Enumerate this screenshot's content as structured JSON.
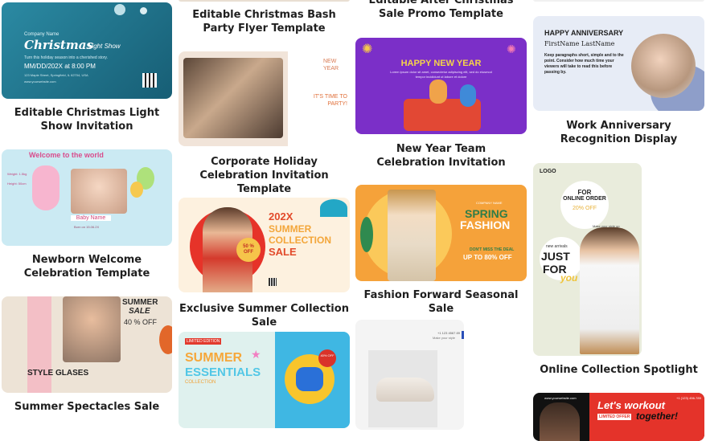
{
  "cards": {
    "christmas_light": {
      "title": "Editable Christmas Light Show Invitation",
      "company": "Company Name",
      "headline": "Christmas",
      "headline_script": "Light Show",
      "tagline": "Turn this holiday season into a cherished story.",
      "datetime": "MM/DD/202X at 8:00 PM",
      "address": "123 Maple Street, Springfield, IL 62704, USA",
      "website": "www.yourwebsite.com"
    },
    "christmas_bash": {
      "title": "Editable Christmas Bash Party Flyer Template"
    },
    "after_christmas": {
      "title": "Editable After Christmas Sale Promo Template"
    },
    "newborn": {
      "title": "Newborn Welcome Celebration Template",
      "welcome": "Welcome to the world",
      "weight": "Weight: 1.5kg",
      "height": "Height: 50cm",
      "baby_name": "Baby Name",
      "born": "Born on 15.06.2X"
    },
    "corporate": {
      "title": "Corporate Holiday Celebration Invitation Template",
      "new_year": "NEW YEAR",
      "party": "IT'S TIME TO PARTY!"
    },
    "new_year_team": {
      "title": "New Year Team Celebration Invitation",
      "headline": "HAPPY NEW YEAR",
      "body": "Lorem ipsum dolor sit amet, consectetur adipiscing elit, sed do eiusmod tempor incididunt ut labore et dolore"
    },
    "work_anniversary": {
      "title": "Work Anniversary Recognition Display",
      "headline": "HAPPY ANNIVERSARY",
      "name": "FirstName LastName",
      "body": "Keep paragraphs short, simple and to the point. Consider how much time your viewers will take to read this before passing by."
    },
    "summer_collection": {
      "title": "Exclusive Summer Collection Sale",
      "year": "202X",
      "summer": "SUMMER",
      "collection": "COLLECTION",
      "sale": "SALE",
      "percent": "50 % OFF"
    },
    "fashion_forward": {
      "title": "Fashion Forward Seasonal Sale",
      "brand": "COMPANY NAME",
      "spring": "SPRING",
      "fashion": "FASHION",
      "deal": "DON'T MISS THE DEAL",
      "upto": "UP TO 80% OFF"
    },
    "online_collection": {
      "title": "Online Collection Spotlight",
      "logo": "LOGO",
      "for": "FOR",
      "online_order": "ONLINE ORDER",
      "off": "20% OFF",
      "make_style": "Make your style up",
      "new_arrivals": "new arrivals",
      "just": "JUST",
      "for_you_1": "FOR",
      "for_you_2": "you"
    },
    "summer_spectacles": {
      "title": "Summer Spectacles Sale",
      "summer": "SUMMER",
      "sale": "SALE",
      "off": "40 % OFF",
      "style": "STYLE GLASES"
    },
    "summer_essentials": {
      "limited": "LIMITED EDITION",
      "summer": "SUMMER",
      "essentials": "ESSENTIALS",
      "collection": "COLLECTION",
      "badge": "40% OFF"
    },
    "sneaker": {
      "phone": "+1 123 4567 89",
      "caption": "Make your style"
    },
    "workout": {
      "site": "www.yourwebsite.com",
      "phone": "+1 (123) 456-789",
      "headline": "Let's workout",
      "limited": "LIMITED OFFER",
      "together": "together!"
    }
  },
  "colors": {
    "christmas_bg": "#1f6e86",
    "newborn_bg": "#cbeaf3",
    "purple": "#7b2fc8",
    "anniversary_bg": "#e7ecf6",
    "summer_bg": "#fdf1df",
    "spring_orange": "#f5a23a",
    "online_bg": "#e9ecdc",
    "glasses_bg": "#ede3d6",
    "essentials_bg": "#dff1ee",
    "workout_red": "#e4332a"
  }
}
